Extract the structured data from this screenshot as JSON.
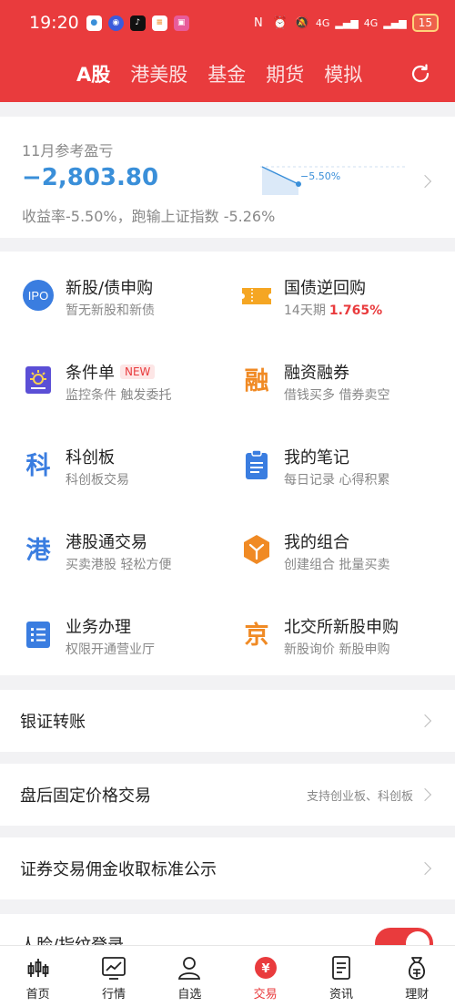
{
  "status_bar": {
    "time": "19:20",
    "signal_1": "4G",
    "signal_2": "4G",
    "battery": "15"
  },
  "header": {
    "tabs": [
      "A股",
      "港美股",
      "基金",
      "期货",
      "模拟"
    ],
    "active_tab": 0
  },
  "profit": {
    "title": "11月参考盈亏",
    "value": "−2,803.80",
    "sparkline_label": "−5.50%",
    "subtitle": "收益率-5.50%，跑输上证指数 -5.26%"
  },
  "services": [
    {
      "title": "新股/债申购",
      "sub": "暂无新股和新债",
      "icon": "ipo-icon",
      "icon_text": "IPO"
    },
    {
      "title": "国债逆回购",
      "sub": "14天期",
      "rate": "1.765%",
      "icon": "ticket-icon"
    },
    {
      "title": "条件单",
      "badge": "NEW",
      "sub": "监控条件 触发委托",
      "icon": "condition-order-icon"
    },
    {
      "title": "融资融券",
      "sub": "借钱买多 借券卖空",
      "icon": "margin-icon",
      "icon_text": "融"
    },
    {
      "title": "科创板",
      "sub": "科创板交易",
      "icon": "star-market-icon",
      "icon_text": "科"
    },
    {
      "title": "我的笔记",
      "sub": "每日记录 心得积累",
      "icon": "notes-icon"
    },
    {
      "title": "港股通交易",
      "sub": "买卖港股 轻松方便",
      "icon": "hk-connect-icon",
      "icon_text": "港"
    },
    {
      "title": "我的组合",
      "sub": "创建组合 批量买卖",
      "icon": "portfolio-icon"
    },
    {
      "title": "业务办理",
      "sub": "权限开通营业厅",
      "icon": "business-icon"
    },
    {
      "title": "北交所新股申购",
      "sub": "新股询价 新股申购",
      "icon": "bse-icon",
      "icon_text": "京"
    }
  ],
  "rows": [
    {
      "label": "银证转账"
    },
    {
      "label": "盘后固定价格交易",
      "hint": "支持创业板、科创板"
    },
    {
      "label": "证券交易佣金收取标准公示"
    },
    {
      "label": "人脸/指纹登录"
    }
  ],
  "bottom_nav": [
    {
      "label": "首页",
      "icon": "home-candles-icon"
    },
    {
      "label": "行情",
      "icon": "market-chart-icon"
    },
    {
      "label": "自选",
      "icon": "watchlist-person-icon"
    },
    {
      "label": "交易",
      "icon": "trade-yuan-icon",
      "icon_text": "¥"
    },
    {
      "label": "资讯",
      "icon": "news-icon"
    },
    {
      "label": "理财",
      "icon": "wealth-bag-icon"
    }
  ],
  "colors": {
    "brand_red": "#e93b3d",
    "profit_blue": "#3a8fd9",
    "rate_red": "#e93b3d",
    "icon_orange": "#f08a24",
    "icon_blue": "#3a7de0"
  }
}
